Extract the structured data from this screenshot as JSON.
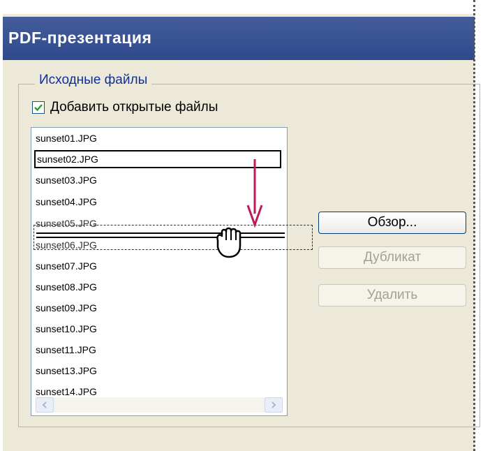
{
  "window": {
    "title": "PDF-презентация"
  },
  "source_files": {
    "group_label": "Исходные файлы",
    "add_open_files": {
      "label": "Добавить открытые файлы",
      "checked": true
    },
    "files": [
      "sunset01.JPG",
      "sunset02.JPG",
      "sunset03.JPG",
      "sunset04.JPG",
      "sunset05.JPG",
      "sunset06.JPG",
      "sunset07.JPG",
      "sunset08.JPG",
      "sunset09.JPG",
      "sunset10.JPG",
      "sunset11.JPG",
      "sunset13.JPG",
      "sunset14.JPG"
    ],
    "selected_file": "sunset02.JPG"
  },
  "buttons": {
    "browse": "Обзор...",
    "duplicate": "Дубликат",
    "remove": "Удалить"
  },
  "colors": {
    "titlebar": "#2f4a8c",
    "drag_arrow": "#c0195a"
  }
}
